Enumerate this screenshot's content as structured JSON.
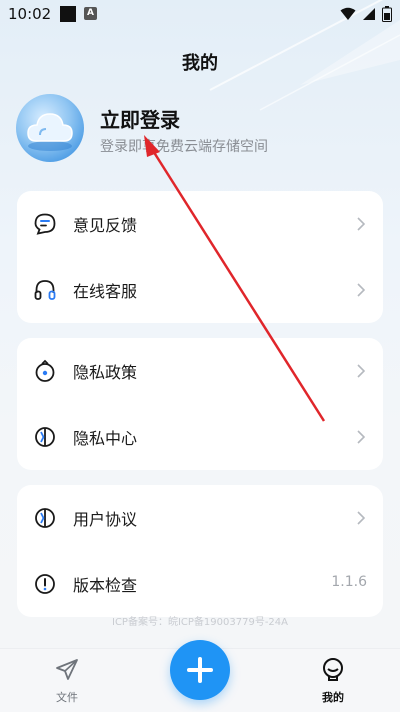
{
  "status_bar": {
    "time": "10:02",
    "a_badge": "A"
  },
  "header": {
    "title": "我的"
  },
  "profile": {
    "login_title": "立即登录",
    "login_subtitle": "登录即享免费云端存储空间"
  },
  "menu_groups": [
    [
      {
        "label": "意见反馈",
        "icon": "feedback-bubble-icon"
      },
      {
        "label": "在线客服",
        "icon": "headphones-icon"
      }
    ],
    [
      {
        "label": "隐私政策",
        "icon": "privacy-policy-icon"
      },
      {
        "label": "隐私中心",
        "icon": "privacy-center-icon"
      }
    ],
    [
      {
        "label": "用户协议",
        "icon": "user-agreement-icon"
      },
      {
        "label": "版本检查",
        "icon": "exclamation-circle-icon",
        "value": "1.1.6"
      }
    ]
  ],
  "icp_text": "ICP备案号：皖ICP备19003779号-24A",
  "bottom_nav": {
    "files_label": "文件",
    "mine_label": "我的"
  },
  "colors": {
    "accent": "#1f94f5",
    "annotation_arrow": "#e0262b",
    "icon_blue": "#2a7bf4"
  }
}
